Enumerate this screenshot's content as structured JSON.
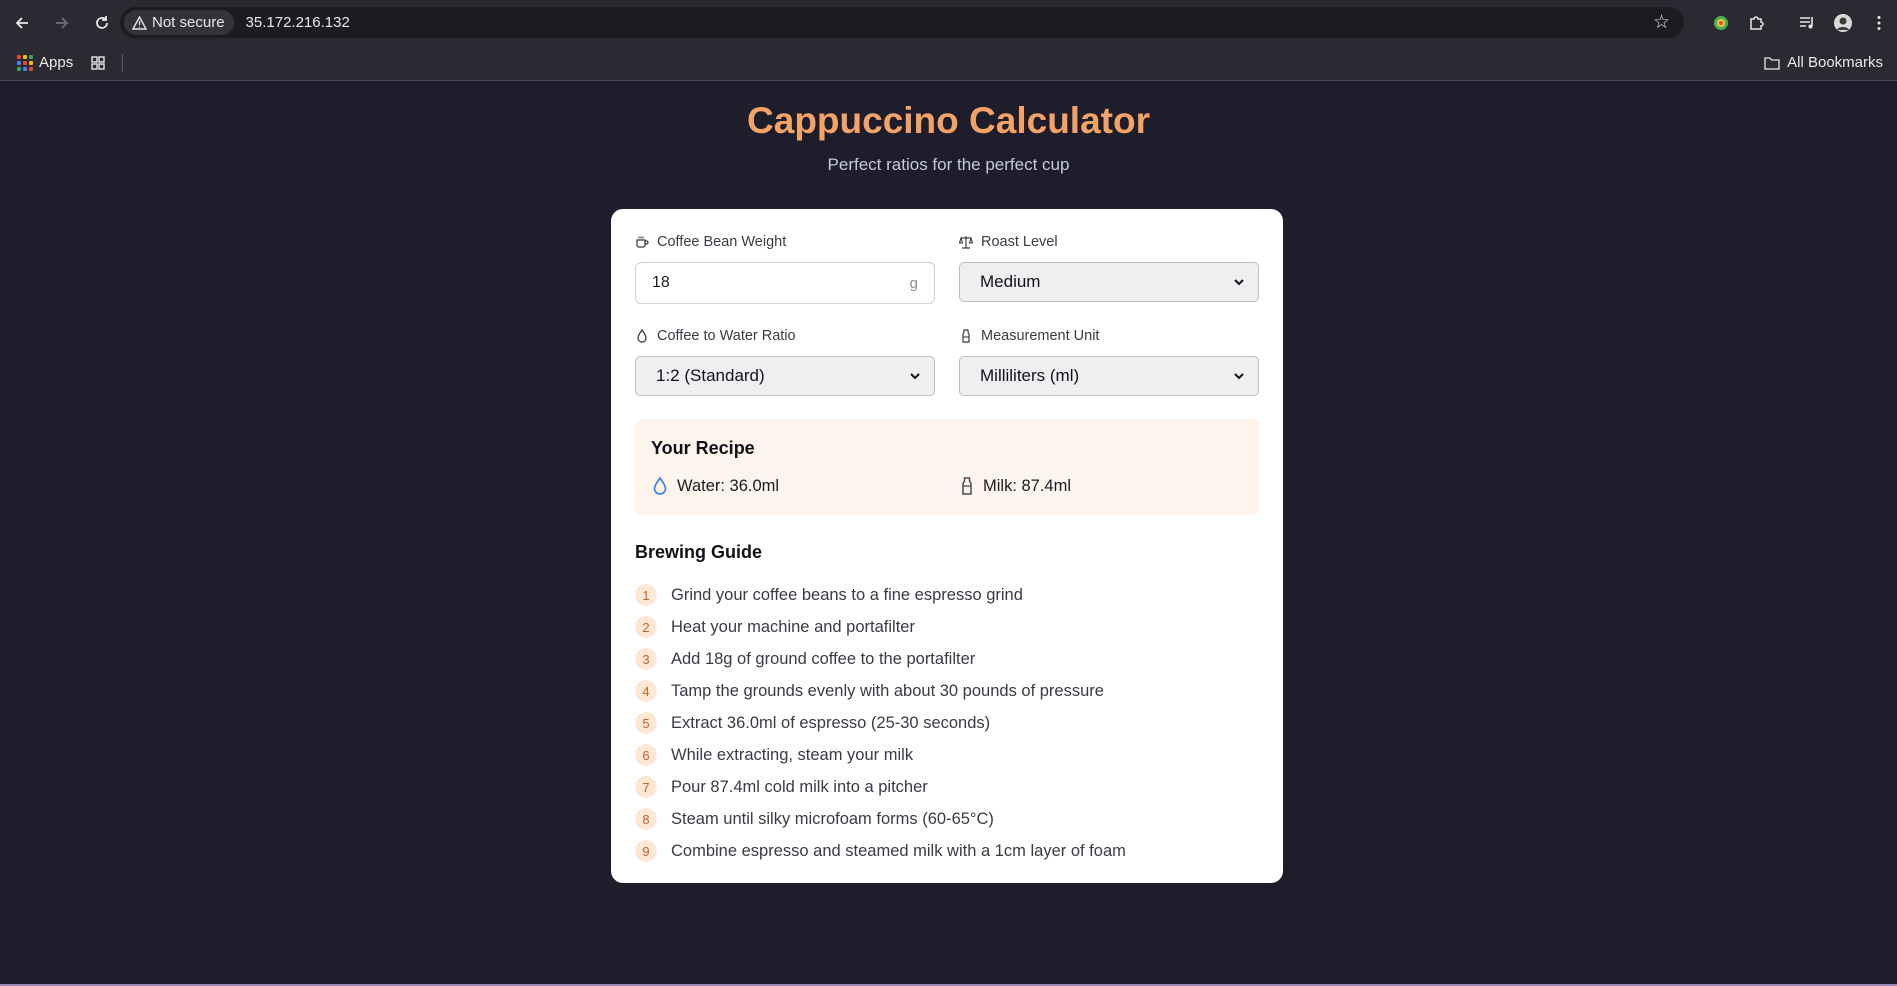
{
  "browser": {
    "security_label": "Not secure",
    "url": "35.172.216.132",
    "bookmarks": {
      "apps_label": "Apps",
      "all_bookmarks_label": "All Bookmarks"
    }
  },
  "page": {
    "title": "Cappuccino Calculator",
    "subtitle": "Perfect ratios for the perfect cup"
  },
  "form": {
    "bean_weight": {
      "label": "Coffee Bean Weight",
      "value": "18",
      "unit": "g"
    },
    "roast_level": {
      "label": "Roast Level",
      "selected": "Medium"
    },
    "ratio": {
      "label": "Coffee to Water Ratio",
      "selected": "1:2 (Standard)"
    },
    "measurement_unit": {
      "label": "Measurement Unit",
      "selected": "Milliliters (ml)"
    }
  },
  "recipe": {
    "title": "Your Recipe",
    "water": "Water: 36.0ml",
    "milk": "Milk: 87.4ml"
  },
  "guide": {
    "title": "Brewing Guide",
    "steps": [
      {
        "num": "1",
        "text": "Grind your coffee beans to a fine espresso grind"
      },
      {
        "num": "2",
        "text": "Heat your machine and portafilter"
      },
      {
        "num": "3",
        "text": "Add 18g of ground coffee to the portafilter"
      },
      {
        "num": "4",
        "text": "Tamp the grounds evenly with about 30 pounds of pressure"
      },
      {
        "num": "5",
        "text": "Extract 36.0ml of espresso (25-30 seconds)"
      },
      {
        "num": "6",
        "text": "While extracting, steam your milk"
      },
      {
        "num": "7",
        "text": "Pour 87.4ml cold milk into a pitcher"
      },
      {
        "num": "8",
        "text": "Steam until silky microfoam forms (60-65°C)"
      },
      {
        "num": "9",
        "text": "Combine espresso and steamed milk with a 1cm layer of foam"
      }
    ]
  },
  "colors": {
    "page_bg": "#1e1d2b",
    "accent": "#f4a366",
    "card_bg": "#ffffff",
    "recipe_bg": "#fff4eb",
    "step_badge_bg": "#fde7d5",
    "step_badge_text": "#c0632a",
    "water_icon": "#3b82f6"
  }
}
